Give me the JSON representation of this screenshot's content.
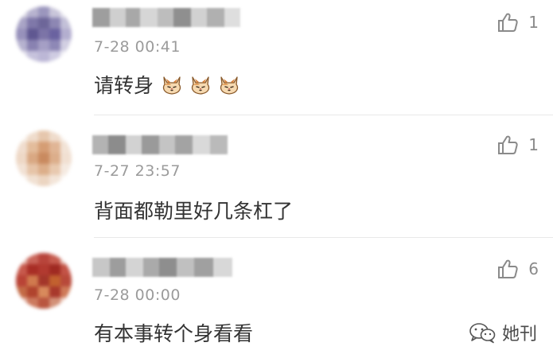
{
  "comments": [
    {
      "timestamp": "7-28 00:41",
      "text": "请转身",
      "likes": "1",
      "emoji_icon": "cat-face-icon",
      "emoji_count": 3
    },
    {
      "timestamp": "7-27 23:57",
      "text": "背面都勒里好几条杠了",
      "likes": "1"
    },
    {
      "timestamp": "7-28 00:00",
      "text": "有本事转个身看看",
      "likes": "6"
    }
  ],
  "watermark": {
    "label": "她刊",
    "icon": "wechat-icon"
  },
  "colors": {
    "timestamp": "#9b9b9b",
    "text": "#333333",
    "divider": "#e8e8e8",
    "like": "#8a8a8a"
  }
}
